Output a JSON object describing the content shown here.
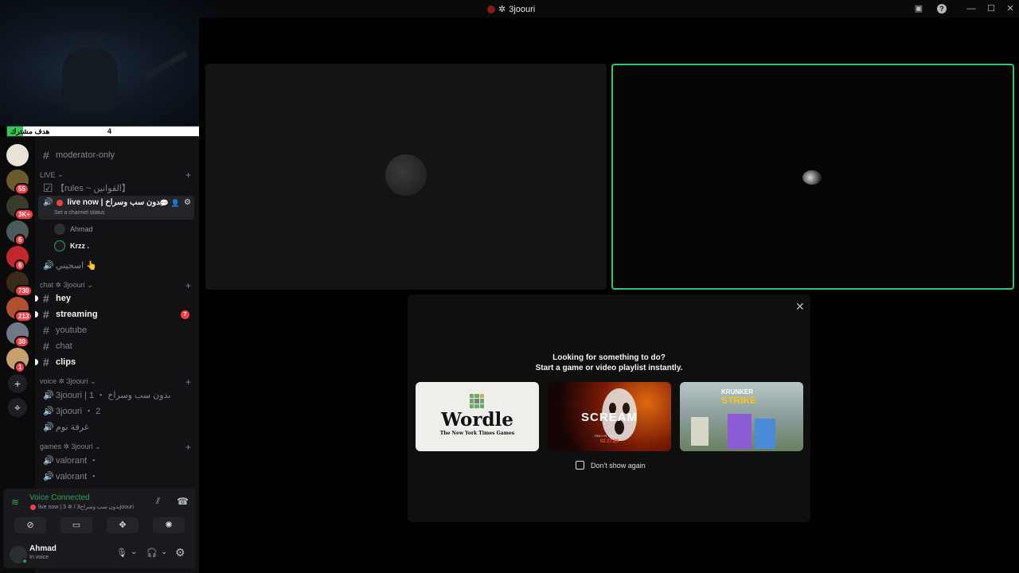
{
  "window": {
    "title": "3joouri",
    "title_prefix": "✲"
  },
  "goal_bar": {
    "label": "هدف مشترك",
    "current": "4",
    "target": "50",
    "progress": 0.08
  },
  "servers": [
    {
      "color": "#e8e3d4",
      "badge": ""
    },
    {
      "color": "#6b5a2e",
      "badge": "55"
    },
    {
      "color": "#3a3a2a",
      "badge": "3K+"
    },
    {
      "color": "#4b5a5a",
      "badge": "6"
    },
    {
      "color": "#c0282d",
      "badge": "6"
    },
    {
      "color": "#3a2a1a",
      "badge": "730"
    },
    {
      "color": "#b05030",
      "badge": "213"
    },
    {
      "color": "#707888",
      "badge": "30"
    },
    {
      "color": "#c8a070",
      "badge": "1"
    }
  ],
  "rail_icons": {
    "add": "+",
    "discover": "⌖"
  },
  "channels": {
    "moderator": "moderator-only",
    "cat_live": "LIVE",
    "rules": "【rules ~ القوانين】",
    "live_now": "live now | بدون سب وسراخ",
    "set_status": "Set a channel status",
    "user1": "Ahmad",
    "user2": "Krzz .",
    "isjini": "اسجيني 👆",
    "cat_chat": "chat ✲ 3joouri",
    "hey": "hey",
    "streaming": "streaming",
    "streaming_badge": "7",
    "youtube": "youtube",
    "chat": "chat",
    "clips": "clips",
    "cat_voice": "voice ✲ 3joouri",
    "v1": "3joouri | 1 ・ بدون سب وسراخ",
    "v2": "3joouri ・ 2",
    "v3": "غرفة نوم",
    "cat_games": "games ✲ 3joouri",
    "g1": "valorant ・",
    "g2": "valorant ・"
  },
  "voice": {
    "status": "Voice Connected",
    "location": "live now | 3 ✲ / بدون سب وسراخ3joouri"
  },
  "user": {
    "name": "Ahmad",
    "status": "In voice"
  },
  "card": {
    "line1": "Looking for something to do?",
    "line2": "Start a game or video playlist instantly.",
    "wordle": "Wordle",
    "wordle_sub": "The New York Times Games",
    "scream": "SCREAM",
    "scream_sub": "ONLY IN THEATERS",
    "scream_date": "02.27.26",
    "krunker": "KRUNKER",
    "krunker2": "STRIKE",
    "dont_show": "Don't show again"
  },
  "colors": {
    "speaking": "#2dc770",
    "voice_green": "#23a55a",
    "badge": "#f23f43"
  }
}
